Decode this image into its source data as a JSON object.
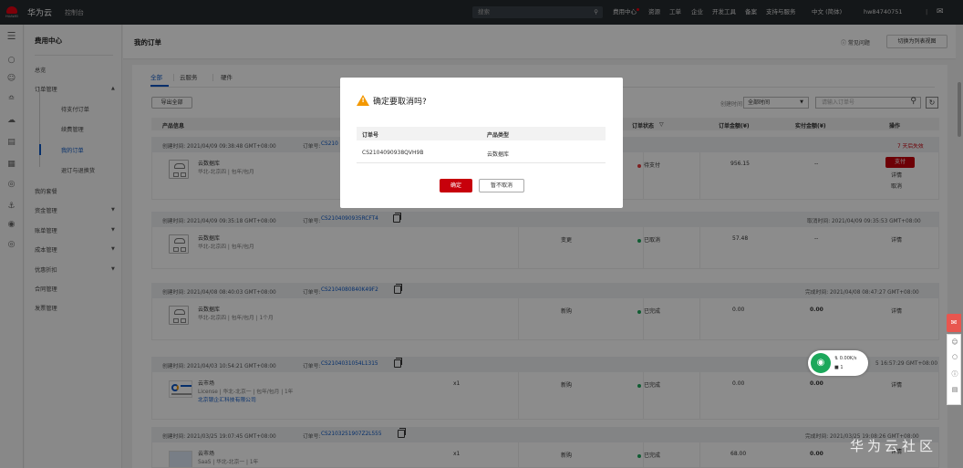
{
  "topbar": {
    "logo_text": "HUAWEI",
    "brand": "华为云",
    "console": "控制台",
    "search_placeholder": "搜索",
    "nav": [
      "费用中心",
      "资源",
      "工单",
      "企业",
      "开发工具",
      "备案",
      "支持与服务",
      "中文 (简体)",
      "hw84740751"
    ]
  },
  "sidebar": {
    "title": "费用中心",
    "items": [
      {
        "label": "总览"
      },
      {
        "label": "订单管理"
      },
      {
        "label": "待支付订单"
      },
      {
        "label": "续费管理"
      },
      {
        "label": "我的订单"
      },
      {
        "label": "退订与退换货"
      },
      {
        "label": "我的套餐"
      },
      {
        "label": "资金管理"
      },
      {
        "label": "账单管理"
      },
      {
        "label": "成本管理"
      },
      {
        "label": "优惠折扣"
      },
      {
        "label": "合同管理"
      },
      {
        "label": "发票管理"
      }
    ]
  },
  "page": {
    "title": "我的订单",
    "faq": "常见问题",
    "switch_btn": "切换为列表视图"
  },
  "tabs": [
    "全部",
    "云服务",
    "硬件"
  ],
  "toolbar": {
    "export": "导出全部",
    "ctime_label": "创建时间",
    "ctime_value": "全部时间",
    "order_placeholder": "请输入订单号"
  },
  "table_headers": {
    "product": "产品信息",
    "status": "订单状态",
    "amount": "订单金额(¥)",
    "paid": "实付金额(¥)",
    "ops": "操作"
  },
  "orders": [
    {
      "created": "创建时间:  2021/04/09 09:38:48 GMT+08:00",
      "order_label": "订单号:",
      "order_no": "CS210",
      "right_text": "7 天后失效",
      "product": "云数据库",
      "desc": "华北-北京四  |  包年/包月",
      "status": "待支付",
      "status_color": "#e6393b",
      "amount": "956.15",
      "paid": "--",
      "ops": [
        "支付",
        "详情",
        "取消"
      ]
    },
    {
      "created": "创建时间:  2021/04/09 09:35:18 GMT+08:00",
      "order_label": "订单号:",
      "order_no": "CS2104090935RCFT4",
      "right_text": "取消时间:  2021/04/09 09:35:53 GMT+08:00",
      "product": "云数据库",
      "desc": "华北-北京四  |  包年/包月",
      "type": "变更",
      "status": "已取消",
      "status_color": "#1ca85b",
      "amount": "57.48",
      "paid": "--",
      "ops": [
        "详情"
      ]
    },
    {
      "created": "创建时间:  2021/04/08 08:40:03 GMT+08:00",
      "order_label": "订单号:",
      "order_no": "CS2104080840K49F2",
      "right_text": "完成时间:  2021/04/08 08:47:27 GMT+08:00",
      "product": "云数据库",
      "desc": "华北-北京四  |  包年/包月  |  1个月",
      "type": "新购",
      "status": "已完成",
      "status_color": "#1ca85b",
      "amount": "0.00",
      "paid": "0.00",
      "ops": [
        "详情"
      ]
    },
    {
      "created": "创建时间:  2021/04/03 10:54:21 GMT+08:00",
      "order_label": "订单号:",
      "order_no": "CS2104031054L1315",
      "right_text": "5 16:57:29 GMT+08:00",
      "product": "云市场",
      "desc": "License  |  华北-北京一  |  包年/包月  |  1年",
      "seller": "北京银企汇科技有限公司",
      "qty": "x1",
      "type": "新购",
      "status": "已完成",
      "status_color": "#1ca85b",
      "amount": "0.00",
      "paid": "0.00",
      "ops": [
        "详情"
      ]
    },
    {
      "created": "创建时间:  2021/03/25 19:07:45 GMT+08:00",
      "order_label": "订单号:",
      "order_no": "CS2103251907Z2L555",
      "right_text": "完成时间:  2021/03/25 19:08:26 GMT+08:00",
      "product": "云市场",
      "desc": "SaaS  |  华北-北京一  |  1年",
      "qty": "x1",
      "type": "新购",
      "status": "已完成",
      "status_color": "#1ca85b",
      "amount": "68.00",
      "paid": "0.00",
      "ops": [
        "详情"
      ]
    }
  ],
  "dialog": {
    "title": "确定要取消吗?",
    "col_order": "订单号",
    "col_type": "产品类型",
    "order_no": "CS2104090938QVH9B",
    "type": "云数据库",
    "ok": "确定",
    "cancel": "暂不取消"
  },
  "network_widget": {
    "speed": "0.00K/s",
    "count": "1"
  },
  "watermark": "华为云社区"
}
